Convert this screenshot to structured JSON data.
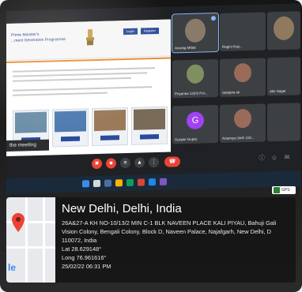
{
  "site": {
    "title_line_1": "Prime Minister's",
    "title_line_2": "...ment Generation Programme",
    "btn_a": "Login",
    "btn_b": "Register"
  },
  "meeting": {
    "join_toast": "the meeting",
    "participants": [
      {
        "name": "Anurag Mittal",
        "avatar": "",
        "color": "#5f6368"
      },
      {
        "name": "Ragini Kup...",
        "avatar": "",
        "color": "#3c4043"
      },
      {
        "name": "",
        "avatar": "",
        "color": "#7a6a58"
      },
      {
        "name": "Priyanka 12(H) Pol...",
        "avatar": "",
        "color": "#4a5a3f"
      },
      {
        "name": "Sanjana sk",
        "avatar": "",
        "color": "#5c4a48"
      },
      {
        "name": "Alin Sagar",
        "avatar": "",
        "color": "#3c4043"
      },
      {
        "name": "Gunjan Gupta",
        "avatar": "G",
        "color": "#a142f4"
      },
      {
        "name": "Anannya Seth 102...",
        "avatar": "",
        "color": "#5c4a48"
      },
      {
        "name": "",
        "avatar": "",
        "color": "#3c4043"
      }
    ]
  },
  "geotag": {
    "title": "New Delhi, Delhi, India",
    "address_1": "26A&27-A KH NO-10/13/2 MIN C-1 BLK NAVEEN PLACE KALI PIYAU, Bahuji Gali",
    "address_2": "Vision Colony, Bengali Colony, Block D, Naveen Palace, Najafgarh, New Delhi, D",
    "pincode": "110072, India",
    "lat": "Lat 28.629148°",
    "long": "Long 76.961616°",
    "datetime": "25/02/22 06:31 PM",
    "map_logo": "le",
    "chip": "GPS"
  }
}
